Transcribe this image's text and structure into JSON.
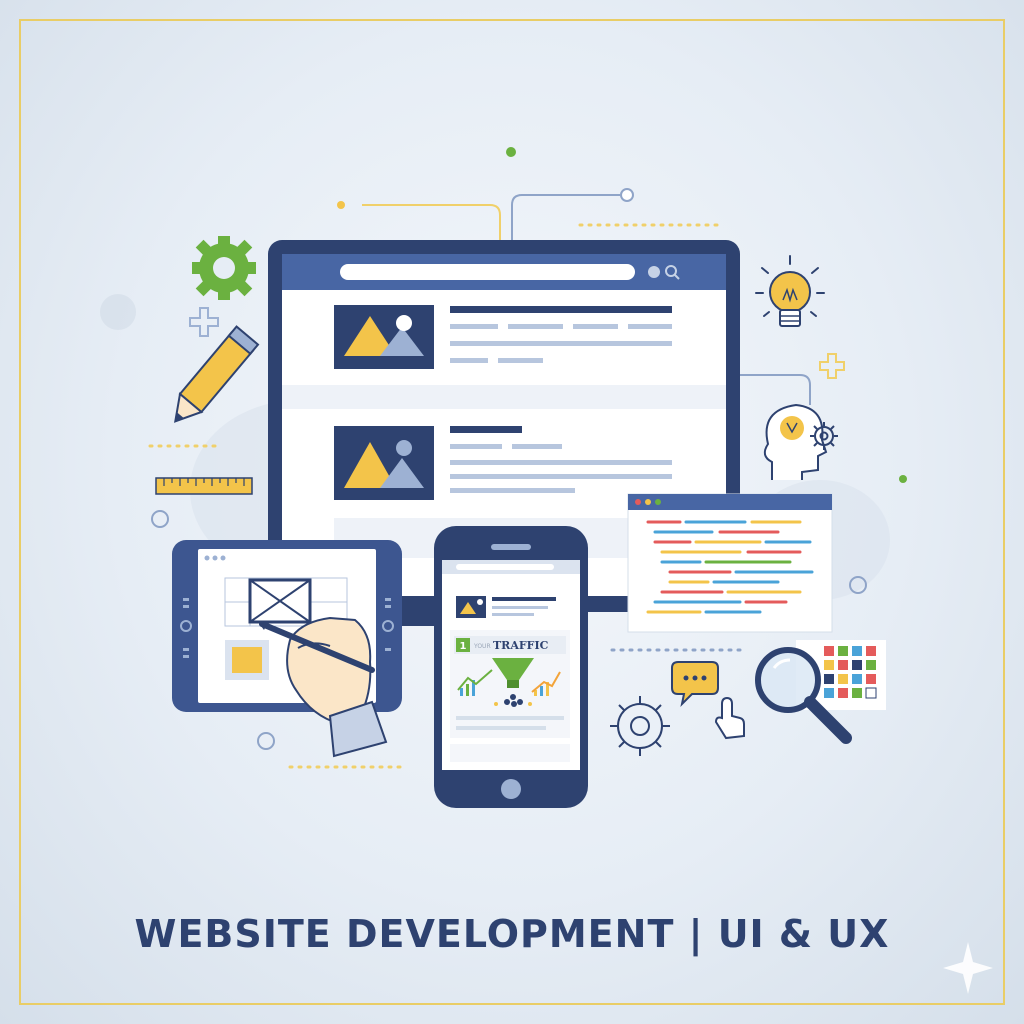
{
  "caption": "WEBSITE DEVELOPMENT | UI & UX",
  "phone": {
    "card_number": "1",
    "card_prefix": "YOUR",
    "card_title": "TRAFFIC"
  },
  "colors": {
    "navy": "#2e4270",
    "blue": "#4866a4",
    "yellow": "#f3c44a",
    "green": "#6bb140",
    "frame": "#e9cd66",
    "background": "#e6edf5"
  },
  "icons": [
    "gear-icon",
    "pencil-icon",
    "ruler-icon",
    "plus-icon",
    "lightbulb-icon",
    "mind-gear-icon",
    "chat-bubble-icon",
    "cursor-hand-icon",
    "magnifier-icon",
    "color-palette-icon",
    "funnel-icon",
    "image-placeholder-icon"
  ]
}
